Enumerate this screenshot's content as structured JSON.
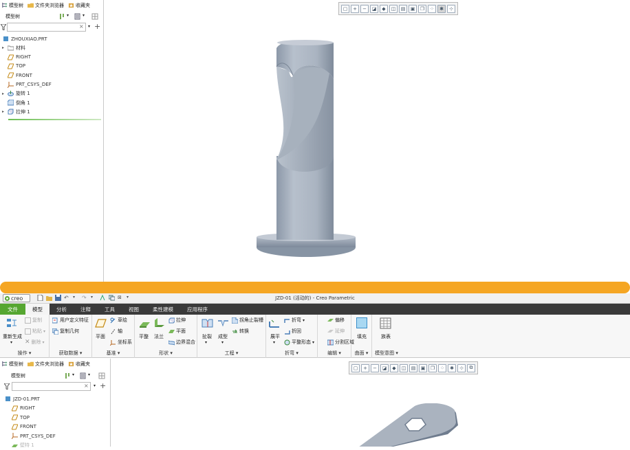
{
  "top_window": {
    "tabs": [
      {
        "label": "模型树"
      },
      {
        "label": "文件夹浏览器"
      },
      {
        "label": "收藏夹"
      }
    ],
    "tree_title": "模型树",
    "search_placeholder": "",
    "search_clear": "×",
    "tree": [
      {
        "label": "ZHOUXIAO.PRT",
        "expander": "",
        "icon": "part-icon"
      },
      {
        "label": "材料",
        "expander": "▸",
        "icon": "material-folder-icon"
      },
      {
        "label": "RIGHT",
        "expander": "",
        "icon": "datum-plane-icon"
      },
      {
        "label": "TOP",
        "expander": "",
        "icon": "datum-plane-icon"
      },
      {
        "label": "FRONT",
        "expander": "",
        "icon": "datum-plane-icon"
      },
      {
        "label": "PRT_CSYS_DEF",
        "expander": "",
        "icon": "csys-icon"
      },
      {
        "label": "旋转 1",
        "expander": "▸",
        "icon": "revolve-icon"
      },
      {
        "label": "倒角 1",
        "expander": "",
        "icon": "chamfer-icon"
      },
      {
        "label": "拉伸 1",
        "expander": "▸",
        "icon": "extrude-icon"
      }
    ]
  },
  "bottom_window": {
    "app_logo": "creo",
    "window_title": "JZD-01 (活动的) - Creo Parametric",
    "menus": [
      {
        "label": "文件",
        "type": "file"
      },
      {
        "label": "模型",
        "type": "active"
      },
      {
        "label": "分析",
        "type": ""
      },
      {
        "label": "注释",
        "type": ""
      },
      {
        "label": "工具",
        "type": ""
      },
      {
        "label": "视图",
        "type": ""
      },
      {
        "label": "柔性建模",
        "type": ""
      },
      {
        "label": "应用程序",
        "type": ""
      }
    ],
    "ribbon": {
      "operations": {
        "label": "操作",
        "regenerate": "重新生成",
        "copy": "复制",
        "paste": "粘贴",
        "delete": "删除"
      },
      "get_data": {
        "label": "获取数据",
        "udf": "用户定义特征",
        "copy_geom": "复制几何"
      },
      "datum": {
        "label": "基准",
        "plane": "平面",
        "sketch": "草绘",
        "axis": "轴",
        "csys": "坐标系"
      },
      "shapes": {
        "label": "形状",
        "flat": "平整",
        "flange": "法兰",
        "extrude": "拉伸",
        "plane": "平面",
        "boundary_blend": "边界混合"
      },
      "engineering": {
        "label": "工程",
        "tear": "扯裂",
        "form": "成型",
        "corner_relief": "拐角止裂槽",
        "convert": "转换"
      },
      "bends": {
        "label": "折弯",
        "unbend": "展平",
        "bend": "折弯",
        "bend_back": "折回",
        "flat_state": "平整形态"
      },
      "editing": {
        "label": "编辑",
        "offset": "偏移",
        "extend": "延伸",
        "split_area": "分割区域"
      },
      "surfaces": {
        "label": "曲面",
        "fill": "填充"
      },
      "model_intent": {
        "label": "模型意图",
        "table": "族表"
      }
    },
    "tabs": [
      {
        "label": "模型树"
      },
      {
        "label": "文件夹浏览器"
      },
      {
        "label": "收藏夹"
      }
    ],
    "tree_title": "模型树",
    "search_clear": "×",
    "tree": [
      {
        "label": "JZD-01.PRT",
        "icon": "part-icon"
      },
      {
        "label": "RIGHT",
        "icon": "datum-plane-icon"
      },
      {
        "label": "TOP",
        "icon": "datum-plane-icon"
      },
      {
        "label": "FRONT",
        "icon": "datum-plane-icon"
      },
      {
        "label": "PRT_CSYS_DEF",
        "icon": "csys-icon"
      },
      {
        "label": "壁特 1",
        "icon": "wall-icon"
      }
    ]
  },
  "colors": {
    "accent_orange": "#f5a623",
    "file_menu_green": "#56a631",
    "menubar_dark": "#3a3a3a",
    "model_gray": "#9aa6b4"
  }
}
